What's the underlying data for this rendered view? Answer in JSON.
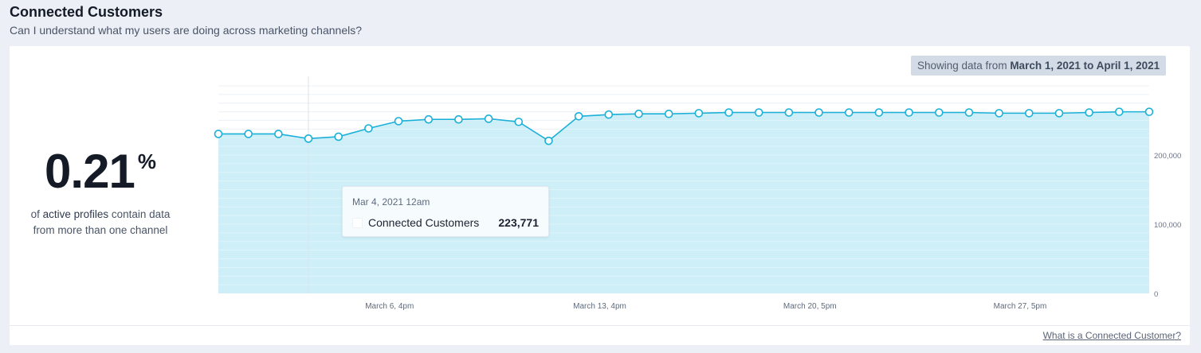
{
  "header": {
    "title": "Connected Customers",
    "subtitle": "Can I understand what my users are doing across marketing channels?"
  },
  "kpi": {
    "value": "0.21",
    "unit": "%",
    "caption_prefix": "of ",
    "caption_emphasis": "active profiles",
    "caption_suffix": " contain data",
    "caption_line2": "from more than one channel"
  },
  "range_badge": {
    "prefix": "Showing data from ",
    "range": "March 1, 2021 to April 1, 2021"
  },
  "tooltip": {
    "date": "Mar 4, 2021 12am",
    "series_name": "Connected Customers",
    "value": "223,771"
  },
  "footer": {
    "link": "What is a Connected Customer?"
  },
  "colors": {
    "line": "#1ab0d8",
    "fill": "#cbeef8",
    "grid": "#e4ebf2"
  },
  "chart_data": {
    "type": "area",
    "series": [
      {
        "name": "Connected Customers",
        "values": [
          230500,
          230500,
          230500,
          223771,
          226500,
          238500,
          249000,
          251500,
          251500,
          252500,
          248000,
          220500,
          256000,
          258500,
          259500,
          259500,
          260500,
          261500,
          261500,
          261500,
          261500,
          261500,
          261500,
          261500,
          261500,
          261500,
          260500,
          260500,
          260500,
          261500,
          262500,
          262500
        ]
      }
    ],
    "yticks": [
      0,
      100000,
      200000
    ],
    "ytick_labels": [
      "0",
      "100,000",
      "200,000"
    ],
    "ylim": [
      0,
      300000
    ],
    "xtick_labels": [
      "March 6, 4pm",
      "March 13, 4pm",
      "March 20, 5pm",
      "March 27, 5pm"
    ],
    "xtick_positions": [
      5.7,
      12.7,
      19.7,
      26.7
    ],
    "highlight_index": 3,
    "grid": true
  }
}
